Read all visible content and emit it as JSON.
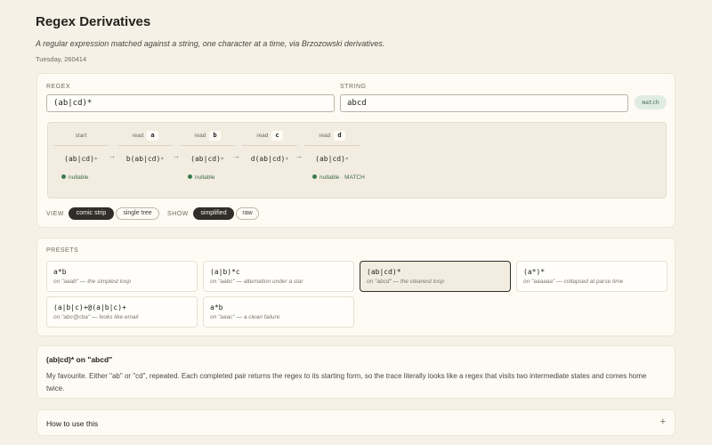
{
  "header": {
    "title": "Regex Derivatives",
    "subtitle": "A regular expression matched against a string, one character at a time, via Brzozowski derivatives.",
    "date": "Tuesday, 260414"
  },
  "inputs": {
    "regex_label": "REGEX",
    "regex_value": "(ab|cd)*",
    "string_label": "STRING",
    "string_value": "abcd",
    "match_label": "match"
  },
  "strip": {
    "read_prefix": "read",
    "steps": [
      {
        "head": "start",
        "char": "",
        "expr": "(ab|cd)",
        "star": "*",
        "note": "nullable"
      },
      {
        "head": "",
        "char": "a",
        "expr": "b(ab|cd)",
        "star": "*",
        "note": ""
      },
      {
        "head": "",
        "char": "b",
        "expr": "(ab|cd)",
        "star": "*",
        "note": "nullable"
      },
      {
        "head": "",
        "char": "c",
        "expr": "d(ab|cd)",
        "star": "*",
        "note": ""
      },
      {
        "head": "",
        "char": "d",
        "expr": "(ab|cd)",
        "star": "*",
        "note": "nullable · MATCH"
      }
    ],
    "arrow": "→"
  },
  "controls": {
    "view_label": "VIEW",
    "view_options": [
      "comic strip",
      "single tree"
    ],
    "view_selected": "comic strip",
    "show_label": "SHOW",
    "show_options": [
      "simplified",
      "raw"
    ],
    "show_selected": "simplified"
  },
  "presets": {
    "label": "PRESETS",
    "items": [
      {
        "pattern": "a*b",
        "desc": "on \"aaab\" — the simplest loop"
      },
      {
        "pattern": "(a|b)*c",
        "desc": "on \"aabc\" — alternation under a star"
      },
      {
        "pattern": "(ab|cd)*",
        "desc": "on \"abcd\" — the cleanest loop",
        "selected": true
      },
      {
        "pattern": "(a*)*",
        "desc": "on \"aaaaaa\" — collapsed at parse time"
      },
      {
        "pattern": "(a|b|c)+@(a|b|c)+",
        "desc": "on \"abc@cba\" — looks like email"
      },
      {
        "pattern": "a*b",
        "desc": "on \"aaac\" — a clean failure"
      }
    ]
  },
  "favourite": {
    "title": "(ab|cd)* on \"abcd\"",
    "body": "My favourite. Either \"ab\" or \"cd\", repeated. Each completed pair returns the regex to its starting form, so the trace literally looks like a regex that visits two intermediate states and comes home twice."
  },
  "how": {
    "title": "How to use this",
    "toggle": "+"
  },
  "colors": {
    "background": "#f5f1e6",
    "accent_green": "#3a7a4d",
    "pill_dark": "#2f2e2a"
  }
}
